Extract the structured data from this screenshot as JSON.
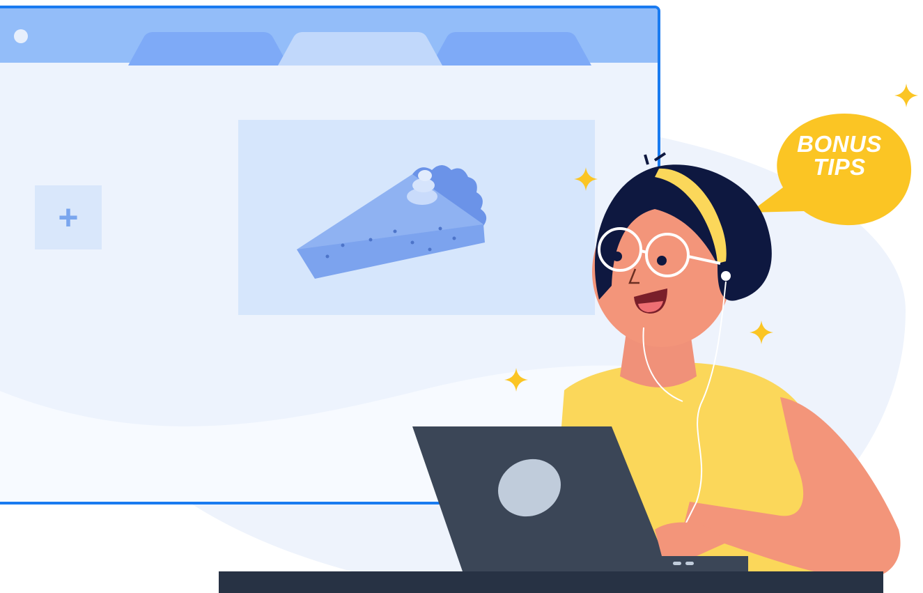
{
  "speech_bubble": {
    "line1": "BONUS",
    "line2": "TIPS",
    "color": "#fbc524"
  },
  "browser": {
    "accent": "#1a7bf0",
    "add_tile_symbol": "+",
    "image_subject": "pie-slice"
  },
  "icons": [
    "plus-icon",
    "sparkle-icon",
    "pie-icon"
  ],
  "colors": {
    "desk": "#273244",
    "laptop": "#3b4657",
    "shirt": "#fbd75a",
    "skin": "#f3957a",
    "hair": "#0e1840"
  }
}
